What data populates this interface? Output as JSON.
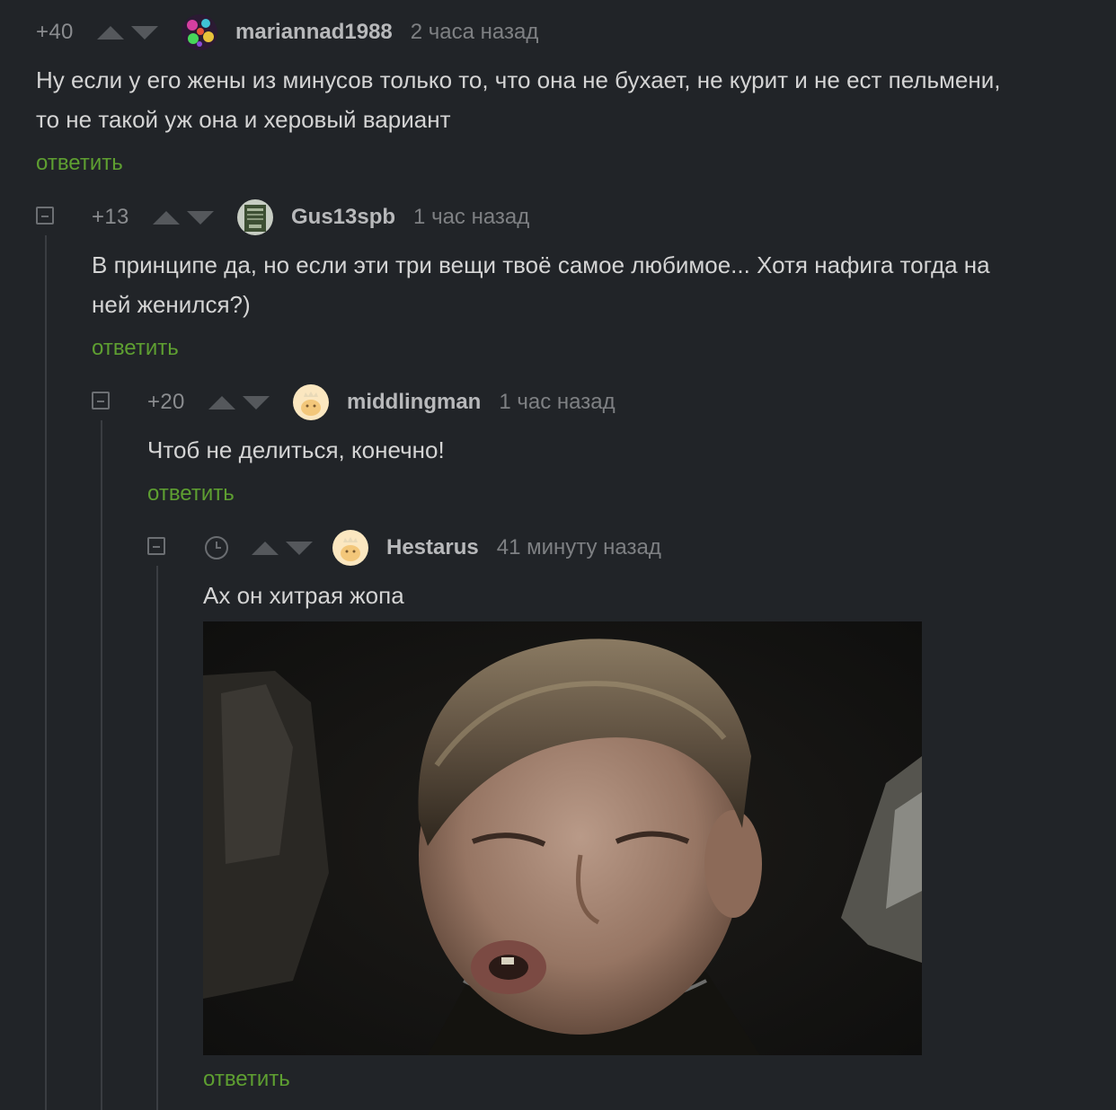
{
  "comments": [
    {
      "rating": "+40",
      "username": "mariannad1988",
      "time": "2 часа назад",
      "text_line1": "Ну если у его жены из минусов только то, что она не бухает, не курит и не ест пельмени,",
      "text_line2": "то не такой уж она и херовый вариант",
      "reply": "ответить"
    },
    {
      "rating": "+13",
      "username": "Gus13spb",
      "time": "1 час назад",
      "text_line1": "В принципе да, но если эти три вещи твоё самое любимое... Хотя нафига тогда на",
      "text_line2": "ней женился?)",
      "reply": "ответить"
    },
    {
      "rating": "+20",
      "username": "middlingman",
      "time": "1 час назад",
      "text_line1": "Чтоб не делиться, конечно!",
      "reply": "ответить"
    },
    {
      "rating_icon": "clock-icon",
      "username": "Hestarus",
      "time": "41 минуту назад",
      "text_line1": "Ах он хитрая жопа",
      "image": "photo of a squinting boy",
      "reply": "ответить"
    }
  ],
  "colors": {
    "background": "#212428",
    "reply_link": "#5e9f31",
    "text": "#d4d4d4",
    "meta": "#7e8083"
  }
}
